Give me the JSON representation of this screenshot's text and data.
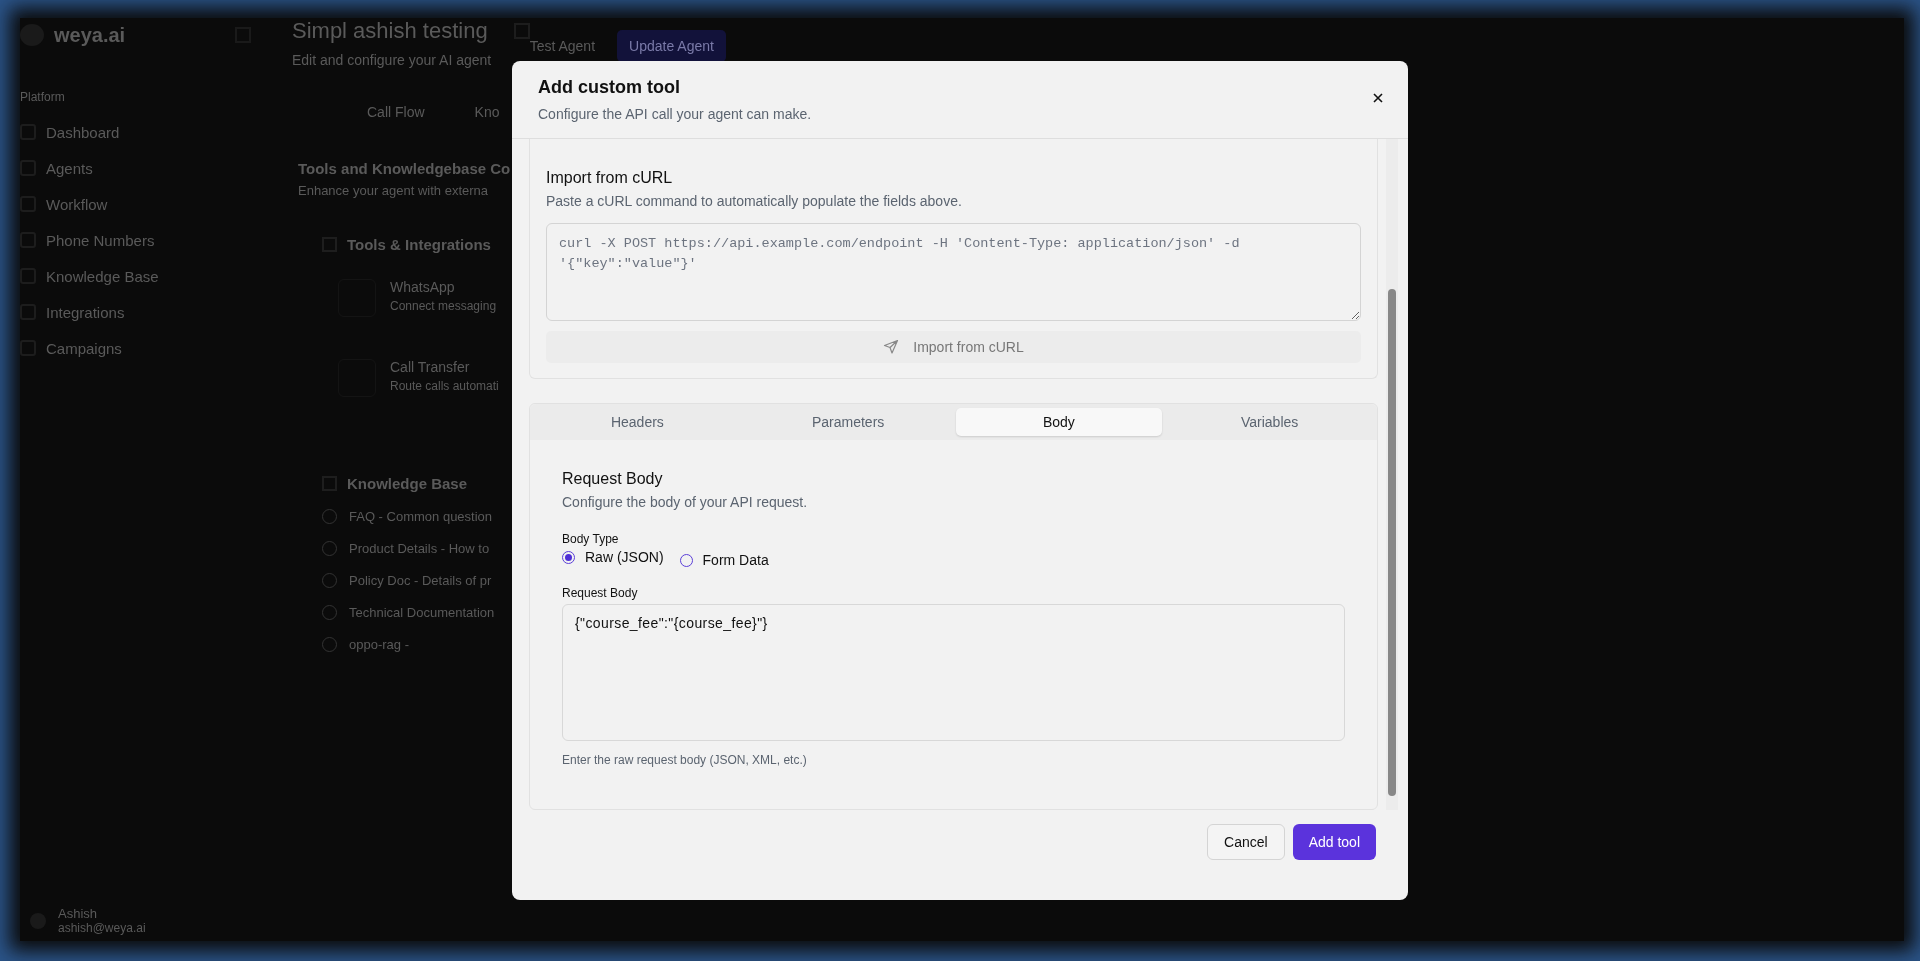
{
  "app": {
    "logo": "weya.ai",
    "sidebar": {
      "section": "Platform",
      "items": [
        {
          "label": "Dashboard"
        },
        {
          "label": "Agents"
        },
        {
          "label": "Workflow"
        },
        {
          "label": "Phone Numbers"
        },
        {
          "label": "Knowledge Base"
        },
        {
          "label": "Integrations"
        },
        {
          "label": "Campaigns"
        }
      ]
    },
    "user": {
      "name": "Ashish",
      "email": "ashish@weya.ai"
    }
  },
  "page": {
    "title": "Simpl ashish testing",
    "subtitle": "Edit and configure your AI agent",
    "tabs": [
      {
        "label": "Call Flow"
      },
      {
        "label": "Kno"
      }
    ],
    "actions": {
      "test": "Test Agent",
      "update": "Update Agent"
    },
    "section_title": "Tools and Knowledgebase Co",
    "section_subtitle": "Enhance your agent with externa",
    "tools_heading": "Tools & Integrations",
    "tools": [
      {
        "name": "WhatsApp",
        "description": "Connect messaging"
      },
      {
        "name": "Call Transfer",
        "description": "Route calls automati"
      }
    ],
    "kb_heading": "Knowledge Base",
    "kb_items": [
      {
        "label": "FAQ - Common question",
        "checked": false
      },
      {
        "label": "Product Details - How to",
        "checked": false
      },
      {
        "label": "Policy Doc - Details of pr",
        "checked": false
      },
      {
        "label": "Technical Documentation",
        "checked": false
      },
      {
        "label": "oppo-rag -",
        "checked": false
      }
    ]
  },
  "dialog": {
    "title": "Add custom tool",
    "subtitle": "Configure the API call your agent can make.",
    "import": {
      "title": "Import from cURL",
      "description": "Paste a cURL command to automatically populate the fields above.",
      "placeholder": "curl -X POST https://api.example.com/endpoint -H 'Content-Type: application/json' -d '{\"key\":\"value\"}'",
      "button": "Import from cURL"
    },
    "tabs": [
      {
        "label": "Headers",
        "selected": false
      },
      {
        "label": "Parameters",
        "selected": false
      },
      {
        "label": "Body",
        "selected": true
      },
      {
        "label": "Variables",
        "selected": false
      }
    ],
    "body": {
      "title": "Request Body",
      "description": "Configure the body of your API request.",
      "type_label": "Body Type",
      "types": [
        {
          "label": "Raw (JSON)",
          "selected": true
        },
        {
          "label": "Form Data",
          "selected": false
        }
      ],
      "field_label": "Request Body",
      "value": "{\"course_fee\":\"{course_fee}\"}",
      "hint": "Enter the raw request body (JSON, XML, etc.)"
    },
    "buttons": [
      {
        "label": "Cancel",
        "kind": "secondary"
      },
      {
        "label": "Add tool",
        "kind": "primary"
      }
    ]
  }
}
